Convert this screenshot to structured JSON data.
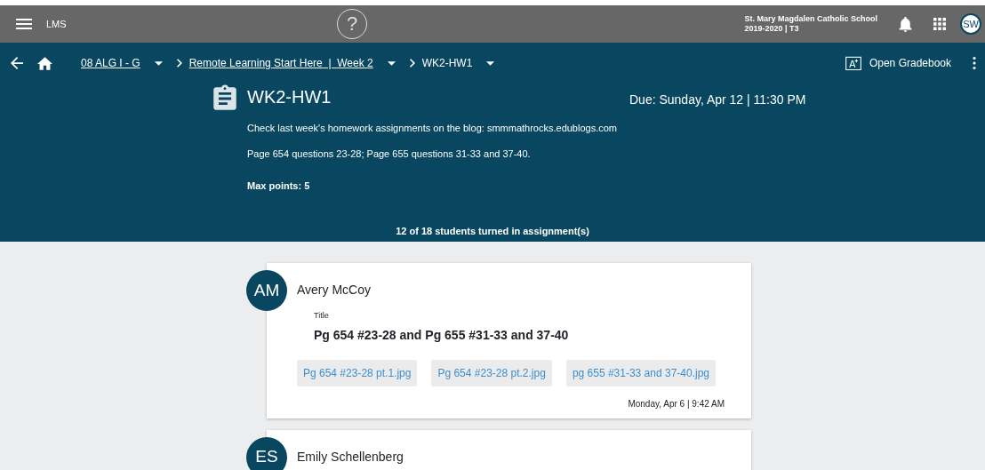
{
  "app_bar": {
    "title": "LMS",
    "help_glyph": "?",
    "school": "St. Mary Magdalen Catholic School",
    "term": "2019-2020 | T3",
    "user_initials": "SW"
  },
  "breadcrumbs": [
    {
      "label": "08 ALG I - G",
      "underlined": true
    },
    {
      "label": "Remote Learning Start Here  |  Week 2",
      "underlined": true
    },
    {
      "label": "WK2-HW1",
      "underlined": false
    }
  ],
  "gradebook_button": "Open Gradebook",
  "assignment": {
    "title": "WK2-HW1",
    "due": "Due: Sunday, Apr 12 | 11:30 PM",
    "description": [
      "Check last week's homework assignments on the blog:  smmmathrocks.edublogs.com",
      "Page 654 questions 23-28; Page 655 questions 31-33 and 37-40."
    ],
    "max_points": "Max points: 5",
    "turned_in": "12 of 18 students turned in assignment(s)"
  },
  "submissions": [
    {
      "initials": "AM",
      "name": "Avery McCoy",
      "title_label": "Title",
      "title": "Pg 654 #23-28 and Pg 655 #31-33 and 37-40",
      "files": [
        "Pg 654 #23-28 pt.1.jpg",
        "Pg 654 #23-28 pt.2.jpg",
        "pg 655 #31-33 and 37-40.jpg"
      ],
      "submitted": "Monday, Apr 6 | 9:42 AM"
    },
    {
      "initials": "ES",
      "name": "Emily Schellenberg"
    }
  ]
}
